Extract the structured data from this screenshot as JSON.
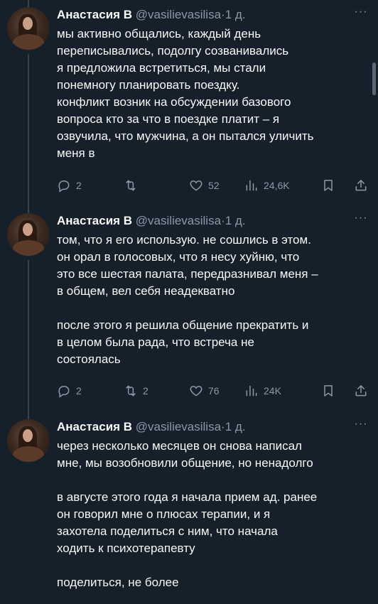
{
  "tweets": [
    {
      "name": "Анастасия В",
      "handle": "@vasilievasilisa",
      "separator": "·",
      "time": "1 д.",
      "more": "···",
      "text": "мы активно общались, каждый день\nпереписывались, подолгу созванивались\nя предложила встретиться, мы стали\nпонемногу планировать поездку.\nконфликт возник на обсуждении базового\nвопроса кто за что в поездке платит – я\nозвучила, что мужчина, а он пытался уличить\nменя в",
      "replies": "2",
      "retweets": "",
      "likes": "52",
      "views": "24,6K"
    },
    {
      "name": "Анастасия В",
      "handle": "@vasilievasilisa",
      "separator": "·",
      "time": "1 д.",
      "more": "···",
      "text": "том, что я его использую. не сошлись в этом.\nон орал в голосовых, что я несу хуйню, что\nэто все шестая палата, передразнивал меня –\nв общем, вел себя неадекватно\n\nпосле этого я решила общение прекратить и\nв целом была рада, что встреча не\nсостоялась",
      "replies": "2",
      "retweets": "2",
      "likes": "76",
      "views": "24K"
    },
    {
      "name": "Анастасия В",
      "handle": "@vasilievasilisa",
      "separator": "·",
      "time": "1 д.",
      "more": "···",
      "text": "через несколько месяцев он снова написал\nмне, мы возобновили общение, но ненадолго\n\nв августе этого года я начала прием ад. ранее\nон говорил мне о плюсах терапии, и я\nзахотела поделиться с ним, что начала\nходить к психотерапевту\n\nподелиться, не более"
    }
  ],
  "icons": {
    "reply": "reply-icon",
    "retweet": "retweet-icon",
    "like": "heart-icon",
    "views": "views-icon",
    "bookmark": "bookmark-icon",
    "share": "share-icon"
  }
}
